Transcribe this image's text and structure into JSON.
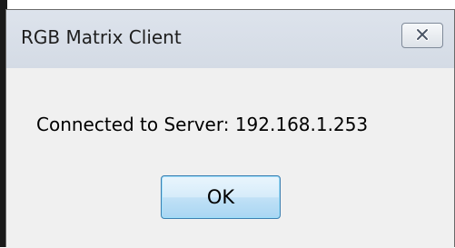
{
  "window": {
    "title": "RGB Matrix Client"
  },
  "dialog": {
    "message": "Connected to Server: 192.168.1.253",
    "ok_label": "OK"
  },
  "icons": {
    "close": "close-icon"
  }
}
